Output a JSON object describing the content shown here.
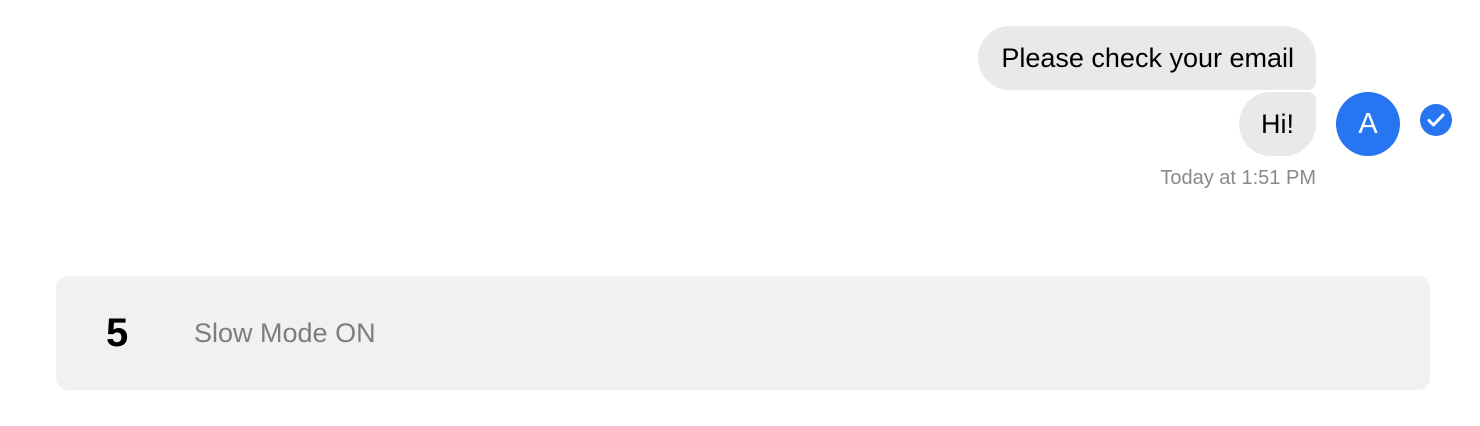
{
  "messages": [
    {
      "text": "Please check your email"
    },
    {
      "text": "Hi!"
    }
  ],
  "avatar": {
    "initial": "A",
    "color": "#2775f0"
  },
  "read_receipt": {
    "icon": "checkmark-icon",
    "color": "#2775f0"
  },
  "timestamp": "Today at 1:51 PM",
  "slow_mode": {
    "countdown": "5",
    "label": "Slow Mode ON"
  },
  "colors": {
    "bubble": "#e9e9eb",
    "bar_background": "#f1f1f1",
    "muted_text": "#8a8a8e"
  }
}
